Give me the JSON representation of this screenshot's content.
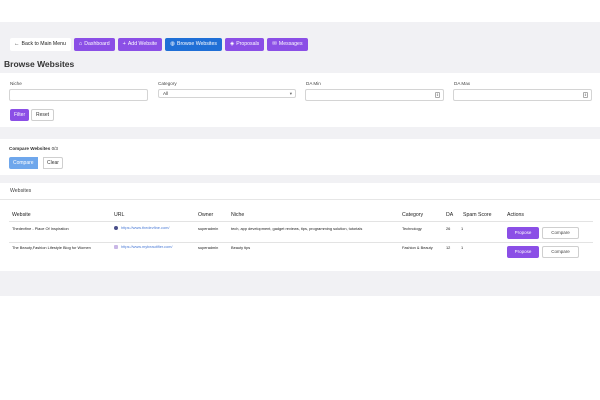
{
  "nav": {
    "back": "Back to Main Menu",
    "dashboard": "Dashboard",
    "add_website": "Add Website",
    "browse_websites": "Browse Websites",
    "proposals": "Proposals",
    "messages": "Messages"
  },
  "page_title": "Browse Websites",
  "filters": {
    "niche_label": "Niche",
    "niche_value": "",
    "category_label": "Category",
    "category_value": "All",
    "da_min_label": "DA Min",
    "da_max_label": "DA Max",
    "filter_button": "Filter",
    "reset_button": "Reset"
  },
  "compare": {
    "label": "Compare Websites",
    "count": "0/3",
    "compare_button": "Compare",
    "clear_button": "Clear"
  },
  "websites": {
    "title": "Websites",
    "columns": [
      "Website",
      "URL",
      "Owner",
      "Niche",
      "Category",
      "DA",
      "Spam Score",
      "Actions"
    ],
    "rows": [
      {
        "website": "Thedevfine - Place Of Inspiration",
        "url": "https://www.thedevfine.com/",
        "owner": "superadmin",
        "niche": "tech, app development, gadget reviews, tips, programming solution, tutorials",
        "category": "Technology",
        "da": "26",
        "spam": "1",
        "propose": "Propose",
        "compare": "Compare"
      },
      {
        "website": "The Beauty,Fashion Lifestyle Blog for Women",
        "url": "https://www.mybeautifier.com/",
        "owner": "superadmin",
        "niche": "Beauty tips",
        "category": "Fashion & Beauty",
        "da": "12",
        "spam": "1",
        "propose": "Propose",
        "compare": "Compare"
      }
    ]
  },
  "colors": {
    "accent": "#8b4fe6",
    "active": "#1f6fd6",
    "compare": "#6fa7ec"
  }
}
